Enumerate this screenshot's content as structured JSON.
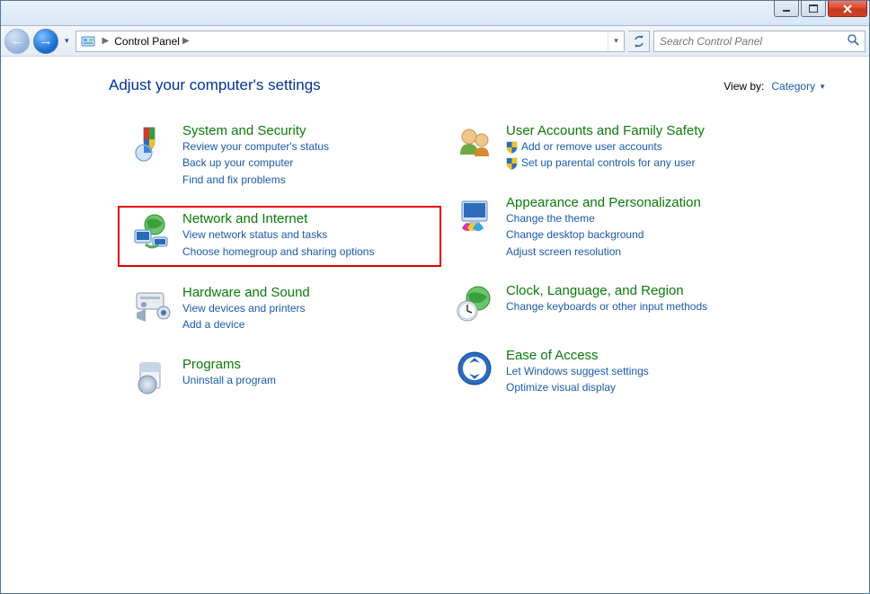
{
  "breadcrumb": {
    "root_icon": "control-panel",
    "item": "Control Panel"
  },
  "search": {
    "placeholder": "Search Control Panel"
  },
  "page": {
    "title": "Adjust your computer's settings",
    "viewby_label": "View by:",
    "viewby_value": "Category"
  },
  "left": [
    {
      "title": "System and Security",
      "links": [
        "Review your computer's status",
        "Back up your computer",
        "Find and fix problems"
      ],
      "shields": []
    },
    {
      "title": "Network and Internet",
      "links": [
        "View network status and tasks",
        "Choose homegroup and sharing options"
      ],
      "shields": [],
      "highlight": true
    },
    {
      "title": "Hardware and Sound",
      "links": [
        "View devices and printers",
        "Add a device"
      ],
      "shields": []
    },
    {
      "title": "Programs",
      "links": [
        "Uninstall a program"
      ],
      "shields": []
    }
  ],
  "right": [
    {
      "title": "User Accounts and Family Safety",
      "links": [
        "Add or remove user accounts",
        "Set up parental controls for any user"
      ],
      "shields": [
        0,
        1
      ]
    },
    {
      "title": "Appearance and Personalization",
      "links": [
        "Change the theme",
        "Change desktop background",
        "Adjust screen resolution"
      ],
      "shields": []
    },
    {
      "title": "Clock, Language, and Region",
      "links": [
        "Change keyboards or other input methods"
      ],
      "shields": []
    },
    {
      "title": "Ease of Access",
      "links": [
        "Let Windows suggest settings",
        "Optimize visual display"
      ],
      "shields": []
    }
  ]
}
